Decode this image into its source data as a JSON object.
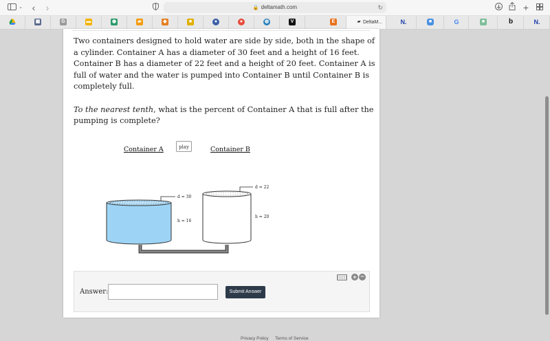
{
  "browser": {
    "url": "deltamath.com",
    "active_tab_title": "DeltaM...",
    "colors": {
      "toolbar": "#f6f6f6",
      "tabbar": "#e8e8e8"
    }
  },
  "question": {
    "paragraph1": "Two containers designed to hold water are side by side, both in the shape of a cylinder. Container A has a diameter of 30 feet and a height of 16 feet. Container B has a diameter of 22 feet and a height of 20 feet. Container A is full of water and the water is pumped into Container B until Container B is completely full.",
    "prompt_emphasis": "To the nearest tenth",
    "prompt_rest": ", what is the percent of Container A that is full after the pumping is complete?"
  },
  "diagram": {
    "container_a_label": "Container A",
    "container_b_label": "Container B",
    "play_label": "play",
    "a_diameter": "d = 30",
    "a_height": "h = 16",
    "b_diameter": "d = 22",
    "b_height": "h = 20",
    "water_color": "#9dd4f5"
  },
  "answer": {
    "label": "Answer:",
    "value": "",
    "submit_label": "Submit Answer"
  },
  "footer": {
    "privacy": "Privacy Policy",
    "terms": "Terms of Service"
  }
}
